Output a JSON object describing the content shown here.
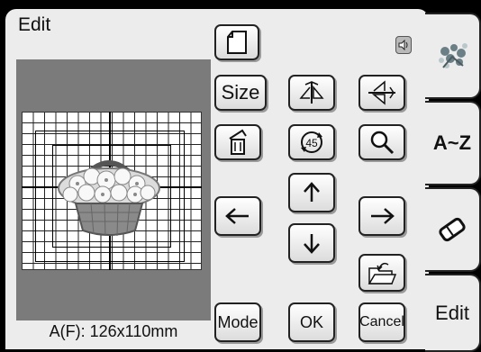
{
  "screen": {
    "title": "Edit",
    "size_info": "A(F): 126x110mm"
  },
  "buttons": {
    "size_label": "Size",
    "mode_label": "Mode",
    "ok_label": "OK",
    "cancel_label": "Cancel"
  },
  "tabs": {
    "alphabet_label": "A~Z",
    "edit_label": "Edit"
  },
  "icons": {
    "new": "page-icon",
    "speaker": "speaker-icon",
    "mirror_horizontal": "mirror-horizontal-icon",
    "mirror_vertical": "mirror-vertical-icon",
    "delete": "trash-icon",
    "rotate": "rotate-45-icon",
    "zoom": "magnifier-icon",
    "move_up": "arrow-up-icon",
    "move_left": "arrow-left-icon",
    "move_right": "arrow-right-icon",
    "move_down": "arrow-down-icon",
    "open_folder": "folder-open-icon",
    "pattern_tab": "embroidery-pattern-icon",
    "eraser_tab": "eraser-icon"
  },
  "colors": {
    "background": "#000000",
    "panel": "#ececec",
    "preview": "#7b7b7b",
    "grid_line": "#222222"
  }
}
